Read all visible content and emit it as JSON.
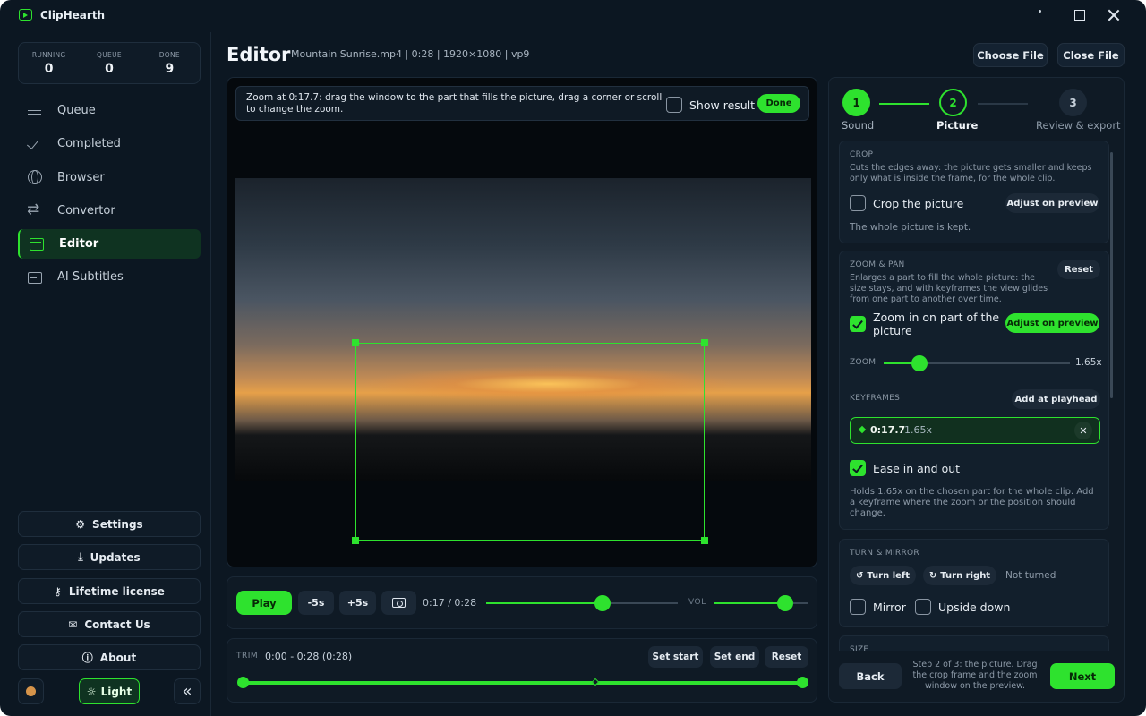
{
  "app": {
    "title": "ClipHearth"
  },
  "stats": [
    {
      "label": "RUNNING",
      "value": "0"
    },
    {
      "label": "QUEUE",
      "value": "0"
    },
    {
      "label": "DONE",
      "value": "9"
    }
  ],
  "nav": [
    {
      "label": "Queue",
      "icon": "list-icon"
    },
    {
      "label": "Completed",
      "icon": "check-icon"
    },
    {
      "label": "Browser",
      "icon": "globe-icon"
    },
    {
      "label": "Convertor",
      "icon": "swap-icon"
    },
    {
      "label": "Editor",
      "icon": "clapper-icon",
      "active": true
    },
    {
      "label": "AI Subtitles",
      "icon": "subtitles-icon"
    }
  ],
  "sidebar_buttons": {
    "settings": "Settings",
    "updates": "Updates",
    "license": "Lifetime license",
    "contact": "Contact Us",
    "about": "About",
    "theme": "Light"
  },
  "header": {
    "title": "Editor",
    "file_meta": "Mountain Sunrise.mp4 | 0:28 | 1920×1080 | vp9",
    "choose_file": "Choose File",
    "close_file": "Close File"
  },
  "preview": {
    "hint": "Zoom at 0:17.7: drag the window to the part that fills the picture, drag a corner or scroll to change the zoom.",
    "show_result": "Show result",
    "show_result_checked": false,
    "done": "Done"
  },
  "playback": {
    "play": "Play",
    "back5": "-5s",
    "fwd5": "+5s",
    "timecode": "0:17 / 0:28",
    "position_fraction": 0.607,
    "volume_label": "VOL",
    "volume_fraction": 0.75
  },
  "trim": {
    "label": "TRIM",
    "range": "0:00 - 0:28  (0:28)",
    "set_start": "Set start",
    "set_end": "Set end",
    "reset": "Reset",
    "start_fraction": 0.0,
    "end_fraction": 1.0
  },
  "steps": [
    {
      "number": "1",
      "label": "Sound",
      "state": "done"
    },
    {
      "number": "2",
      "label": "Picture",
      "state": "current"
    },
    {
      "number": "3",
      "label": "Review & export",
      "state": "upcoming"
    }
  ],
  "crop": {
    "title": "CROP",
    "desc": "Cuts the edges away: the picture gets smaller and keeps only what is inside the frame, for the whole clip.",
    "checkbox": "Crop the picture",
    "checked": false,
    "adjust": "Adjust on preview",
    "status": "The whole picture is kept."
  },
  "zoom": {
    "title": "ZOOM & PAN",
    "desc": "Enlarges a part to fill the whole picture: the size stays, and with keyframes the view glides from one part to another over time.",
    "reset": "Reset",
    "checkbox": "Zoom in on part of the picture",
    "checked": true,
    "adjust": "Adjust on preview",
    "zoom_label": "ZOOM",
    "zoom_value": "1.65x",
    "zoom_fraction": 0.19,
    "keyframes_label": "KEYFRAMES",
    "add_keyframe": "Add at playhead",
    "keyframes": [
      {
        "time": "0:17.7",
        "zoom": "1.65x"
      }
    ],
    "ease": "Ease in and out",
    "ease_checked": true,
    "note": "Holds 1.65x on the chosen part for the whole clip. Add a keyframe where the zoom or the position should change."
  },
  "turn": {
    "title": "TURN & MIRROR",
    "turn_left": "Turn left",
    "turn_right": "Turn right",
    "status": "Not turned",
    "mirror": "Mirror",
    "upside_down": "Upside down"
  },
  "size": {
    "title": "SIZE"
  },
  "footer": {
    "back": "Back",
    "text": "Step 2 of 3: the picture. Drag the crop frame and the zoom window on the preview.",
    "next": "Next"
  },
  "colors": {
    "accent": "#2ee22e",
    "background": "#0c1722",
    "panel": "#0f1a25"
  }
}
